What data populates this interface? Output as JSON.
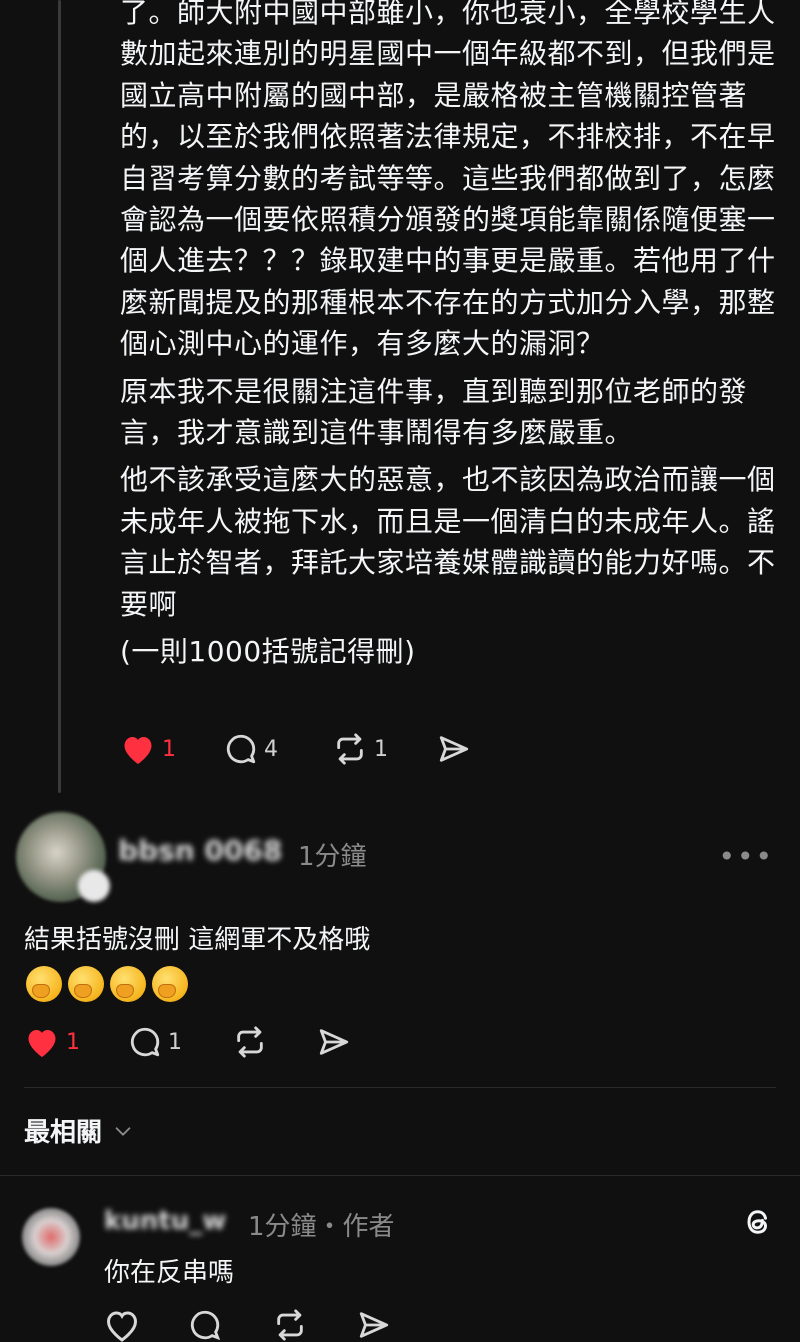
{
  "post": {
    "paragraphs": [
      "了。師大附中國中部雖小，你也衰小，全學校學生人數加起來連別的明星國中一個年級都不到，但我們是國立高中附屬的國中部，是嚴格被主管機關控管著的，以至於我們依照著法律規定，不排校排，不在早自習考算分數的考試等等。這些我們都做到了，怎麼會認為一個要依照積分頒發的獎項能靠關係隨便塞一個人進去？？？錄取建中的事更是嚴重。若他用了什麼新聞提及的那種根本不存在的方式加分入學，那整個心測中心的運作，有多麼大的漏洞？",
      "原本我不是很關注這件事，直到聽到那位老師的發言，我才意識到這件事鬧得有多麼嚴重。",
      "他不該承受這麼大的惡意，也不該因為政治而讓一個未成年人被拖下水，而且是一個清白的未成年人。謠言止於智者，拜託大家培養媒體識讀的能力好嗎。不要啊",
      "(一則1000括號記得刪)"
    ],
    "likes": "1",
    "comments": "4",
    "reposts": "1"
  },
  "reply1": {
    "username": "bbsn 0068",
    "time": "1分鐘",
    "text": "結果括號沒刪 這網軍不及格哦",
    "emoji_count": 4,
    "likes": "1",
    "comments": "1"
  },
  "section": {
    "title": "最相關"
  },
  "reply2": {
    "username": "kuntu_w",
    "time_author": "1分鐘・作者",
    "text": "你在反串嗎"
  },
  "colors": {
    "background": "#101010",
    "like": "#ff3040",
    "secondary": "#8a8a8a"
  }
}
